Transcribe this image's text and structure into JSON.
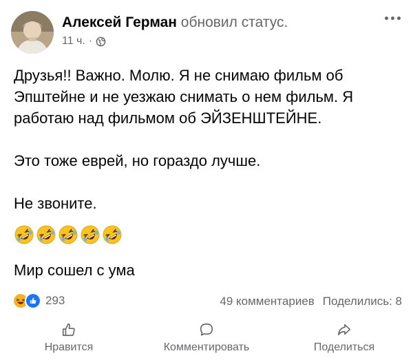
{
  "post": {
    "author": "Алексей Герман",
    "action": "обновил статус.",
    "time": "11 ч.",
    "separator": "·",
    "privacy_icon": "globe-icon",
    "more_icon": "more-horizontal-icon",
    "body": {
      "paragraph1": "Друзья!! Важно. Молю. Я не снимаю фильм об Эпштейне и не уезжаю снимать о нем фильм. Я работаю над фильмом об ЭЙЗЕНШТЕЙНЕ.",
      "paragraph2": "Это  тоже еврей, но гораздо лучше.",
      "paragraph3": "Не звоните.",
      "emoji_count": 5,
      "emoji_name": "rolling-on-floor-laughing",
      "paragraph4": "Мир сошел с ума"
    },
    "reactions": {
      "icons": [
        "haha-reaction-icon",
        "like-reaction-icon"
      ],
      "count": "293"
    },
    "comments": "49 комментариев",
    "shares": "Поделились: 8"
  },
  "actions": {
    "like": "Нравится",
    "comment": "Комментировать",
    "share": "Поделиться"
  },
  "colors": {
    "text": "#050505",
    "secondary": "#65676b",
    "like_blue": "#1877f2",
    "haha_yellow": "#f7b125"
  }
}
